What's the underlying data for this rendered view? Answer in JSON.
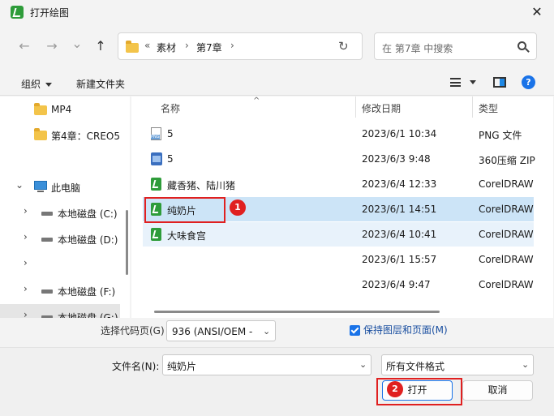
{
  "window": {
    "title": "打开绘图",
    "close": "✕"
  },
  "nav": {
    "back": "←",
    "forward": "→",
    "recent": "⌄",
    "up": "↑"
  },
  "address": {
    "overflow": "«",
    "crumbs": [
      "素材",
      "第7章"
    ],
    "sep": "›",
    "refresh": "↻"
  },
  "search": {
    "placeholder": "在 第7章 中搜索"
  },
  "toolbar": {
    "organize": "组织",
    "new_folder": "新建文件夹",
    "help": "?"
  },
  "sidebar": {
    "items": [
      {
        "label": "MP4",
        "icon": "folder-icon"
      },
      {
        "label": "第4章：CREO5",
        "icon": "folder-icon"
      },
      {
        "label": "此电脑",
        "icon": "computer-icon",
        "chev": "⌄"
      },
      {
        "label": "本地磁盘 (C:)",
        "icon": "drive-icon",
        "chev": "›"
      },
      {
        "label": "本地磁盘 (D:)",
        "icon": "drive-icon",
        "chev": "›"
      },
      {
        "label": "",
        "icon": "",
        "chev": "›"
      },
      {
        "label": "本地磁盘 (F:)",
        "icon": "drive-icon",
        "chev": "›"
      },
      {
        "label": "本地磁盘 (G:)",
        "icon": "drive-icon",
        "chev": "›"
      }
    ]
  },
  "columns": {
    "name": "名称",
    "date": "修改日期",
    "type": "类型",
    "sort": "^"
  },
  "files": [
    {
      "name": "5",
      "date": "2023/6/1 10:34",
      "type": "PNG 文件",
      "icon": "png-icon"
    },
    {
      "name": "5",
      "date": "2023/6/3 9:48",
      "type": "360压缩 ZIP",
      "icon": "zip-icon"
    },
    {
      "name": "藏香猪、陆川猪",
      "date": "2023/6/4 12:33",
      "type": "CorelDRAW",
      "icon": "cdr-icon"
    },
    {
      "name": "纯奶片",
      "date": "2023/6/1 14:51",
      "type": "CorelDRAW",
      "icon": "cdr-icon"
    },
    {
      "name": "大味食宫",
      "date": "2023/6/4 10:41",
      "type": "CorelDRAW",
      "icon": "cdr-icon"
    },
    {
      "name": "",
      "date": "2023/6/1 15:57",
      "type": "CorelDRAW",
      "icon": ""
    },
    {
      "name": "",
      "date": "2023/6/4 9:47",
      "type": "CorelDRAW",
      "icon": ""
    }
  ],
  "encoding": {
    "label": "选择代码页(G)",
    "value": "936  (ANSI/OEM -"
  },
  "keep_layers": {
    "label": "保持图层和页面(M)",
    "checked": true
  },
  "filename": {
    "label": "文件名(N):",
    "value": "纯奶片"
  },
  "filetype": {
    "value": "所有文件格式"
  },
  "buttons": {
    "open": "打开",
    "cancel": "取消"
  },
  "badges": {
    "one": "1",
    "two": "2"
  },
  "colors": {
    "accent": "#1a73e8",
    "selection": "#cce4f7",
    "annotation": "#e02020",
    "coreldraw": "#2e9c3a"
  }
}
